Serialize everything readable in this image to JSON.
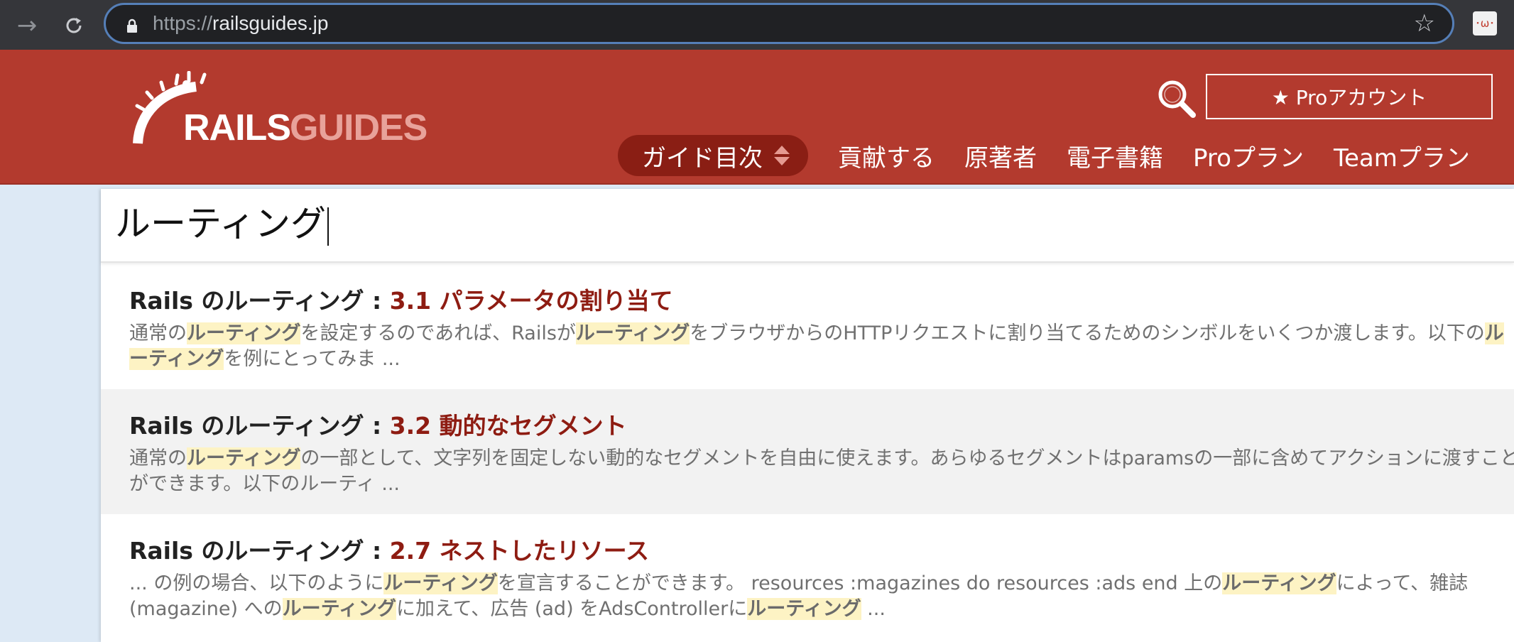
{
  "browser": {
    "url_scheme": "https://",
    "url_host": "railsguides.jp",
    "ext_icon": "･ω･"
  },
  "header": {
    "logo": {
      "rails": "RAILS",
      "guides": "GUIDES"
    },
    "pro_account_label": "★ Proアカウント",
    "nav": {
      "guide_toc": "ガイド目次",
      "contribute": "貢献する",
      "original_authors": "原著者",
      "ebook": "電子書籍",
      "pro_plan": "Proプラン",
      "team_plan": "Teamプラン"
    }
  },
  "search": {
    "query": "ルーティング"
  },
  "results": [
    {
      "guide": "Rails のルーティング : ",
      "section": "3.1 パラメータの割り当て",
      "snippet": [
        {
          "t": "通常の"
        },
        {
          "t": "ルーティング",
          "hl": true
        },
        {
          "t": "を設定するのであれば、Railsが"
        },
        {
          "t": "ルーティング",
          "hl": true
        },
        {
          "t": "をブラウザからのHTTPリクエストに割り当てるためのシンボルをいくつか渡します。以下の"
        },
        {
          "t": "ルーティング",
          "hl": true
        },
        {
          "t": "を例にとってみま ..."
        }
      ]
    },
    {
      "guide": "Rails のルーティング : ",
      "section": "3.2 動的なセグメント",
      "snippet": [
        {
          "t": "通常の"
        },
        {
          "t": "ルーティング",
          "hl": true
        },
        {
          "t": "の一部として、文字列を固定しない動的なセグメントを自由に使えます。あらゆるセグメントはparamsの一部に含めてアクションに渡すことができます。以下のルーティ ..."
        }
      ]
    },
    {
      "guide": "Rails のルーティング : ",
      "section": "2.7 ネストしたリソース",
      "snippet": [
        {
          "t": "... の例の場合、以下のように"
        },
        {
          "t": "ルーティング",
          "hl": true
        },
        {
          "t": "を宣言することができます。 resources :magazines do resources :ads end 上の"
        },
        {
          "t": "ルーティング",
          "hl": true
        },
        {
          "t": "によって、雑誌 (magazine) への"
        },
        {
          "t": "ルーティング",
          "hl": true
        },
        {
          "t": "に加えて、広告 (ad) をAdsControllerに"
        },
        {
          "t": "ルーティング",
          "hl": true
        },
        {
          "t": " ..."
        }
      ]
    }
  ],
  "colors": {
    "header_bg": "#b33a2e",
    "section_title": "#8e1c12",
    "highlight_bg": "#fdf3c4",
    "page_bg": "#dde9f5"
  }
}
